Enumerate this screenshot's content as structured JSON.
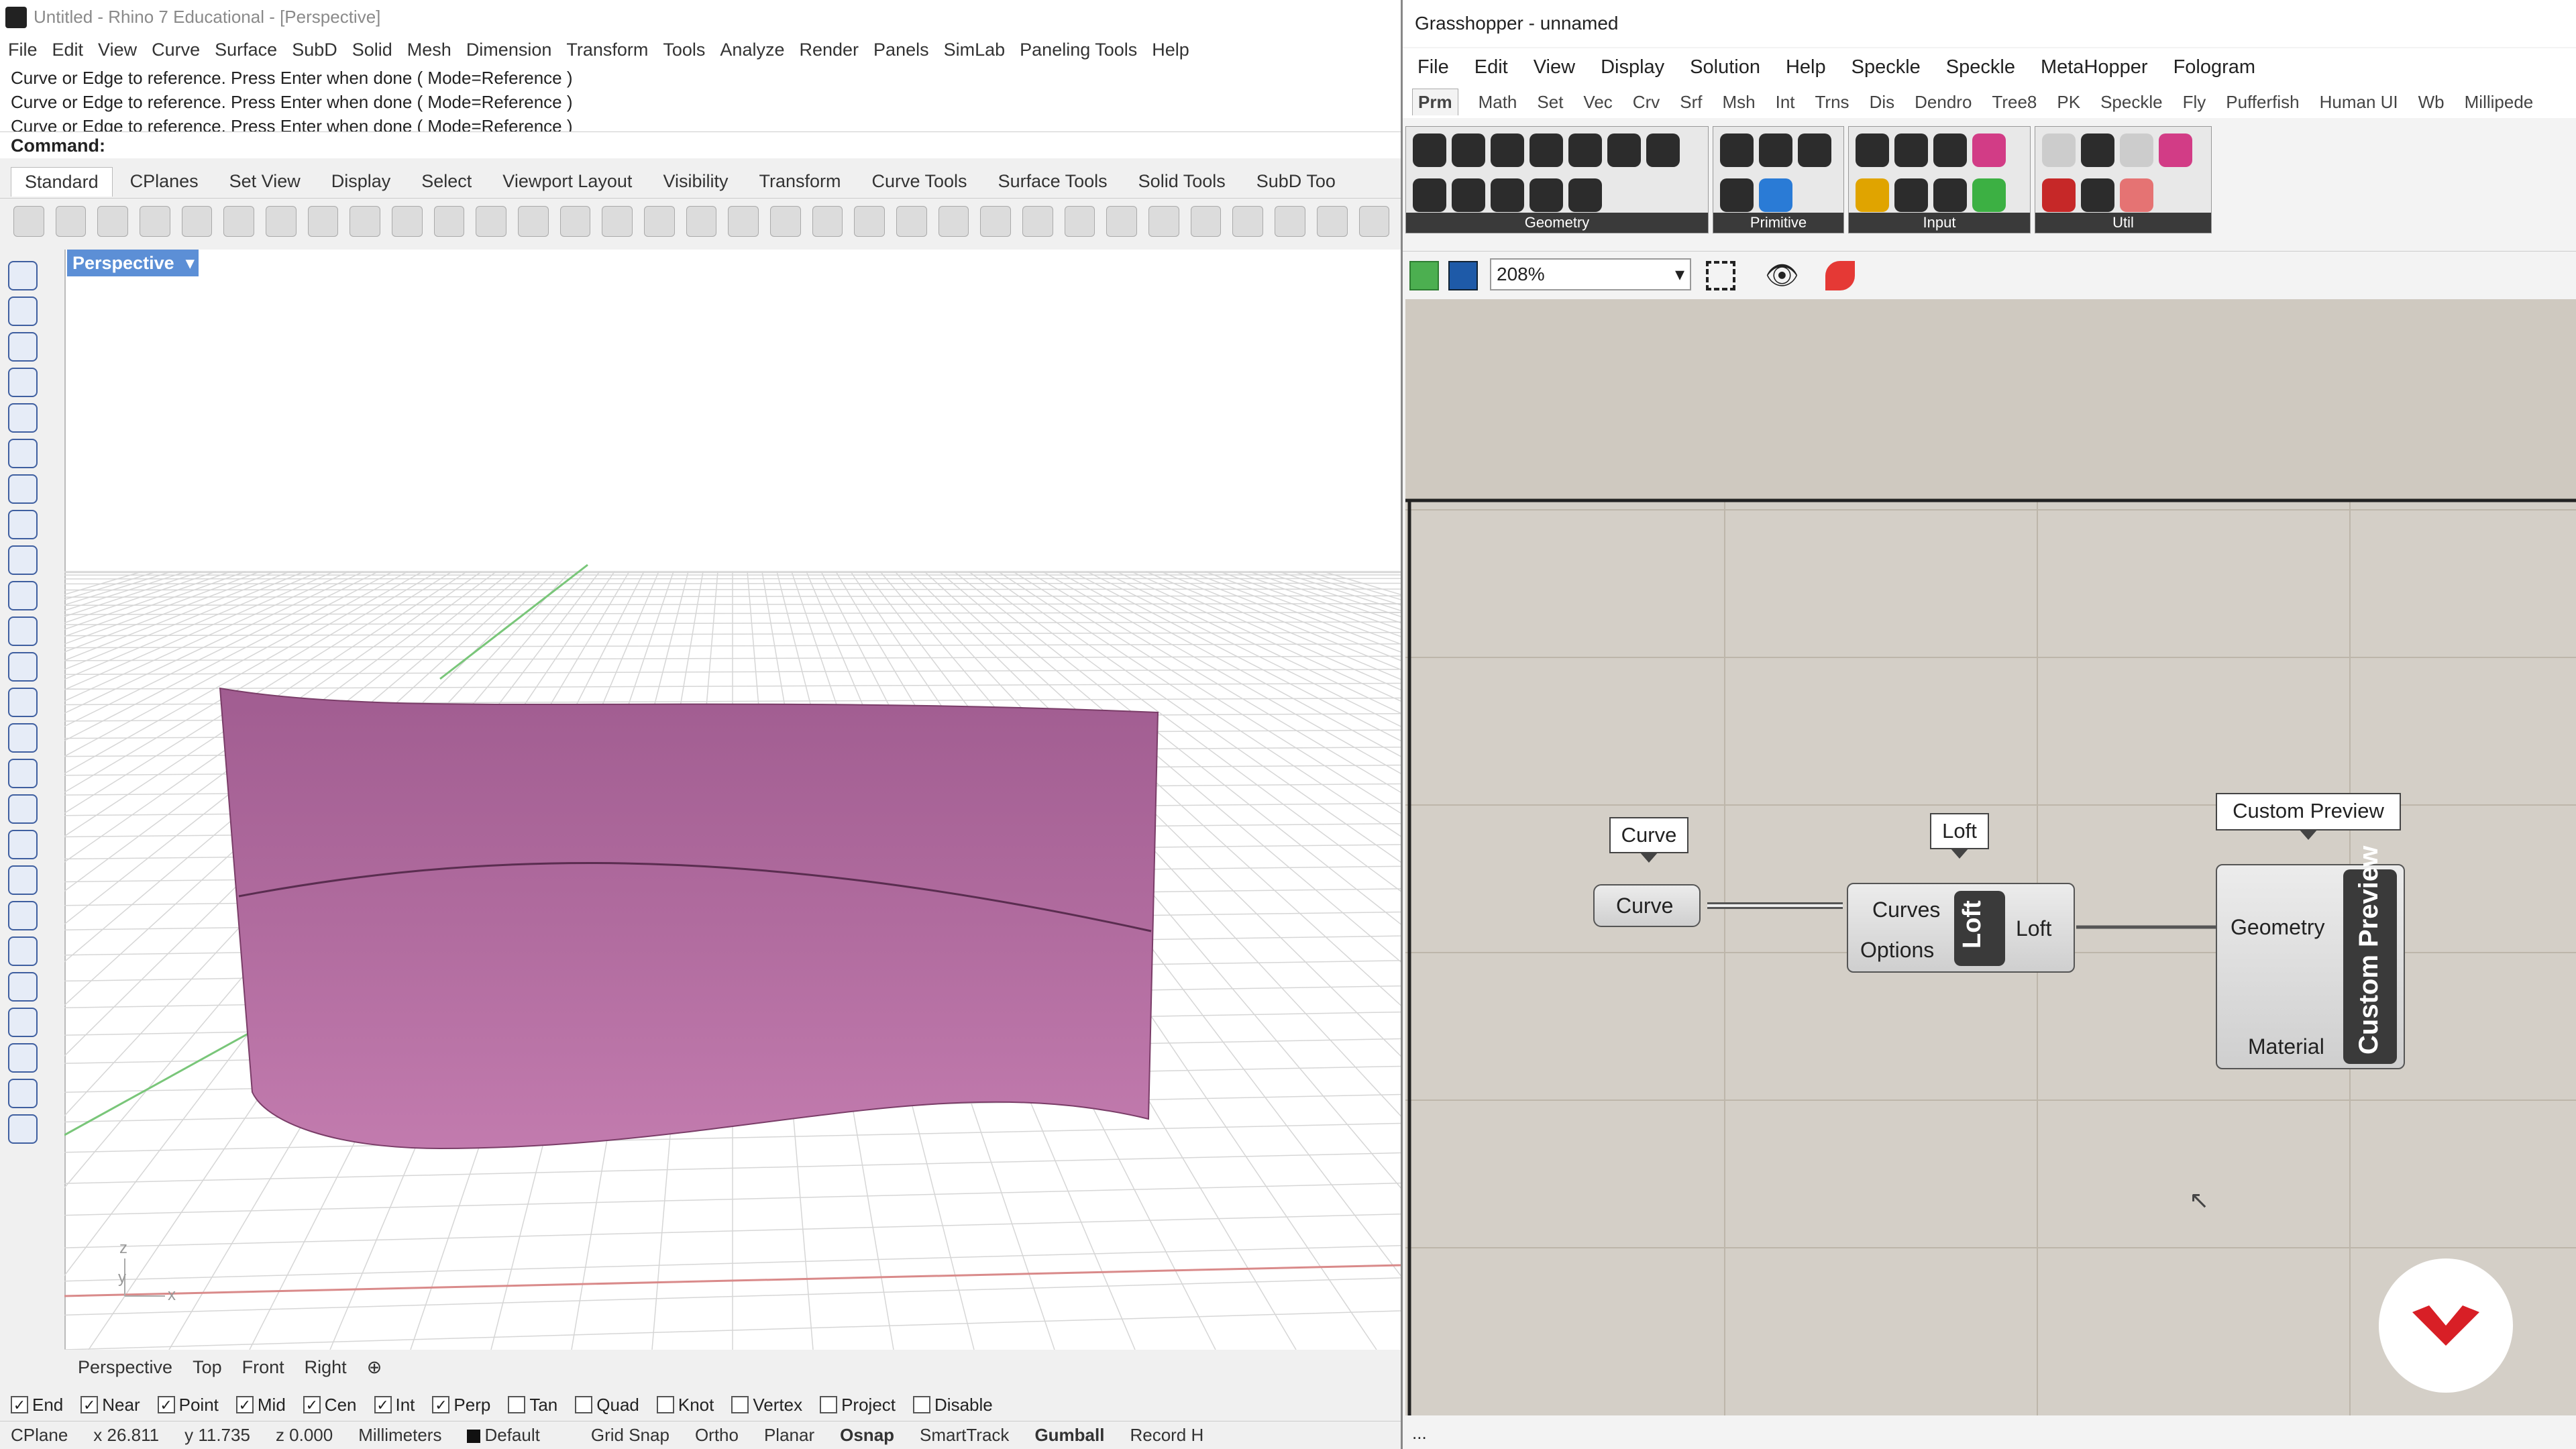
{
  "rhino": {
    "title": "Untitled - Rhino 7 Educational - [Perspective]",
    "menu": [
      "File",
      "Edit",
      "View",
      "Curve",
      "Surface",
      "SubD",
      "Solid",
      "Mesh",
      "Dimension",
      "Transform",
      "Tools",
      "Analyze",
      "Render",
      "Panels",
      "SimLab",
      "Paneling Tools",
      "Help"
    ],
    "history": [
      "Curve or Edge to reference. Press Enter when done ( Mode=Reference )",
      "Curve or Edge to reference. Press Enter when done ( Mode=Reference )",
      "Curve or Edge to reference. Press Enter when done ( Mode=Reference )"
    ],
    "command_label": "Command:",
    "toolbar_tabs": [
      "Standard",
      "CPlanes",
      "Set View",
      "Display",
      "Select",
      "Viewport Layout",
      "Visibility",
      "Transform",
      "Curve Tools",
      "Surface Tools",
      "Solid Tools",
      "SubD Too"
    ],
    "viewport_label": "Perspective",
    "viewport_tabs": [
      "Perspective",
      "Top",
      "Front",
      "Right"
    ],
    "osnap": [
      {
        "label": "End",
        "checked": true
      },
      {
        "label": "Near",
        "checked": true
      },
      {
        "label": "Point",
        "checked": true
      },
      {
        "label": "Mid",
        "checked": true
      },
      {
        "label": "Cen",
        "checked": true
      },
      {
        "label": "Int",
        "checked": true
      },
      {
        "label": "Perp",
        "checked": true
      },
      {
        "label": "Tan",
        "checked": false
      },
      {
        "label": "Quad",
        "checked": false
      },
      {
        "label": "Knot",
        "checked": false
      },
      {
        "label": "Vertex",
        "checked": false
      },
      {
        "label": "Project",
        "checked": false
      },
      {
        "label": "Disable",
        "checked": false
      }
    ],
    "status": {
      "cplane": "CPlane",
      "x": "x 26.811",
      "y": "y 11.735",
      "z": "z 0.000",
      "units": "Millimeters",
      "layer": "Default",
      "toggles": [
        "Grid Snap",
        "Ortho",
        "Planar",
        "Osnap",
        "SmartTrack",
        "Gumball",
        "Record H"
      ]
    },
    "surface_color": "#b56ea3"
  },
  "grasshopper": {
    "title": "Grasshopper - unnamed",
    "menu": [
      "File",
      "Edit",
      "View",
      "Display",
      "Solution",
      "Help",
      "Speckle",
      "Speckle",
      "MetaHopper",
      "Fologram"
    ],
    "tabs": [
      "Prm",
      "Math",
      "Set",
      "Vec",
      "Crv",
      "Srf",
      "Msh",
      "Int",
      "Trns",
      "Dis",
      "Dendro",
      "Tree8",
      "PK",
      "Speckle",
      "Fly",
      "Pufferfish",
      "Human UI",
      "Wb",
      "Millipede"
    ],
    "ribbon_groups": [
      "Geometry",
      "Primitive",
      "Input",
      "Util"
    ],
    "zoom": "208%",
    "canvas": {
      "curve": {
        "bubble": "Curve",
        "label": "Curve"
      },
      "loft": {
        "bubble": "Loft",
        "inputs": [
          "Curves",
          "Options"
        ],
        "name": "Loft",
        "output": "Loft"
      },
      "preview": {
        "bubble": "Custom Preview",
        "inputs": [
          "Geometry",
          "Material"
        ],
        "name": "Custom Preview"
      }
    },
    "bottom_text": "..."
  }
}
